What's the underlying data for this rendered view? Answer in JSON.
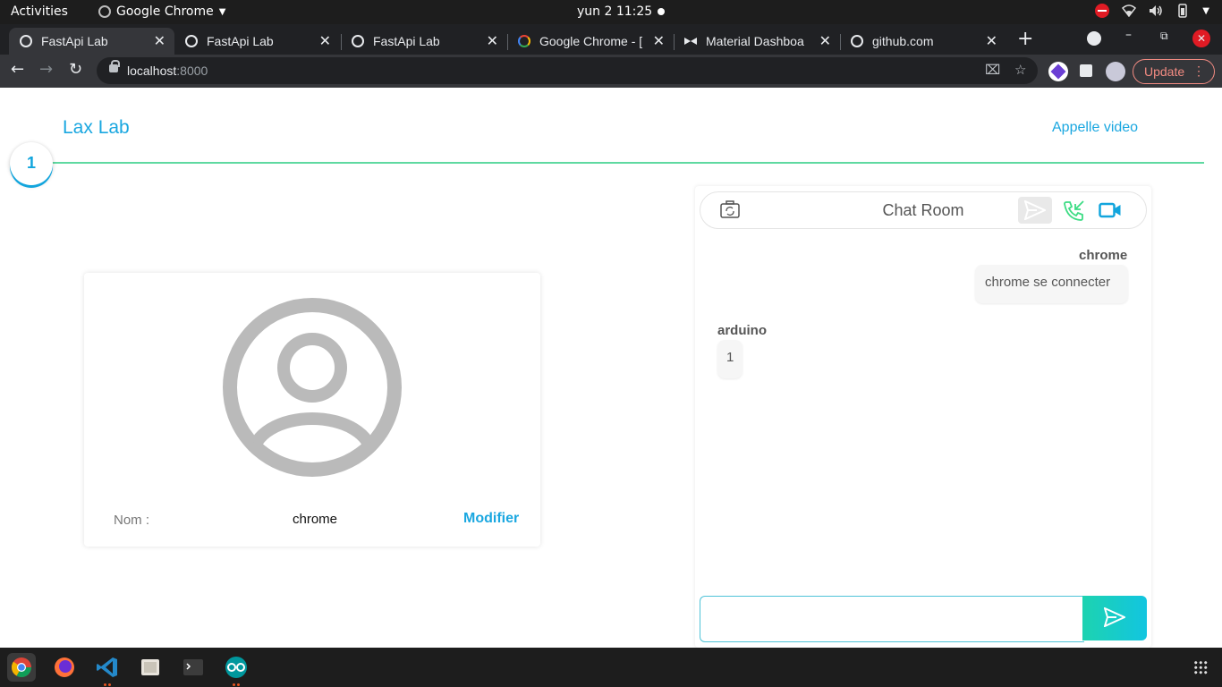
{
  "system_bar": {
    "activities": "Activities",
    "app_name": "Google Chrome",
    "clock": "yun 2  11:25"
  },
  "browser": {
    "tabs": [
      {
        "title": "FastApi Lab",
        "icon": "globe-icon",
        "active": true
      },
      {
        "title": "FastApi Lab",
        "icon": "globe-icon",
        "active": false
      },
      {
        "title": "FastApi Lab",
        "icon": "globe-icon",
        "active": false
      },
      {
        "title": "Google Chrome - [",
        "icon": "chrome-icon",
        "active": false
      },
      {
        "title": "Material Dashboa",
        "icon": "bowtie-icon",
        "active": false
      },
      {
        "title": "github.com",
        "icon": "globe-icon",
        "active": false
      }
    ],
    "url_host": "localhost",
    "url_port": ":8000",
    "update_label": "Update"
  },
  "page": {
    "brand": "Lax Lab",
    "video_link": "Appelle video",
    "step_number": "1",
    "profile": {
      "name_label": "Nom :",
      "name_value": "chrome",
      "modify_label": "Modifier"
    },
    "chat": {
      "title": "Chat Room",
      "messages": [
        {
          "author": "chrome",
          "text": "chrome se connecter",
          "side": "right"
        },
        {
          "author": "arduino",
          "text": "1",
          "side": "left"
        }
      ],
      "input_value": "",
      "input_placeholder": ""
    }
  },
  "colors": {
    "accent": "#1aa7e0",
    "divider": "#5fd9a1",
    "call_icon": "#3ddc84",
    "send_gradient_start": "#1dd3b0",
    "send_gradient_end": "#12c5e0"
  },
  "dock": {
    "apps": [
      "chrome-icon",
      "firefox-icon",
      "vscode-icon",
      "files-icon",
      "terminal-icon",
      "arduino-icon"
    ]
  }
}
